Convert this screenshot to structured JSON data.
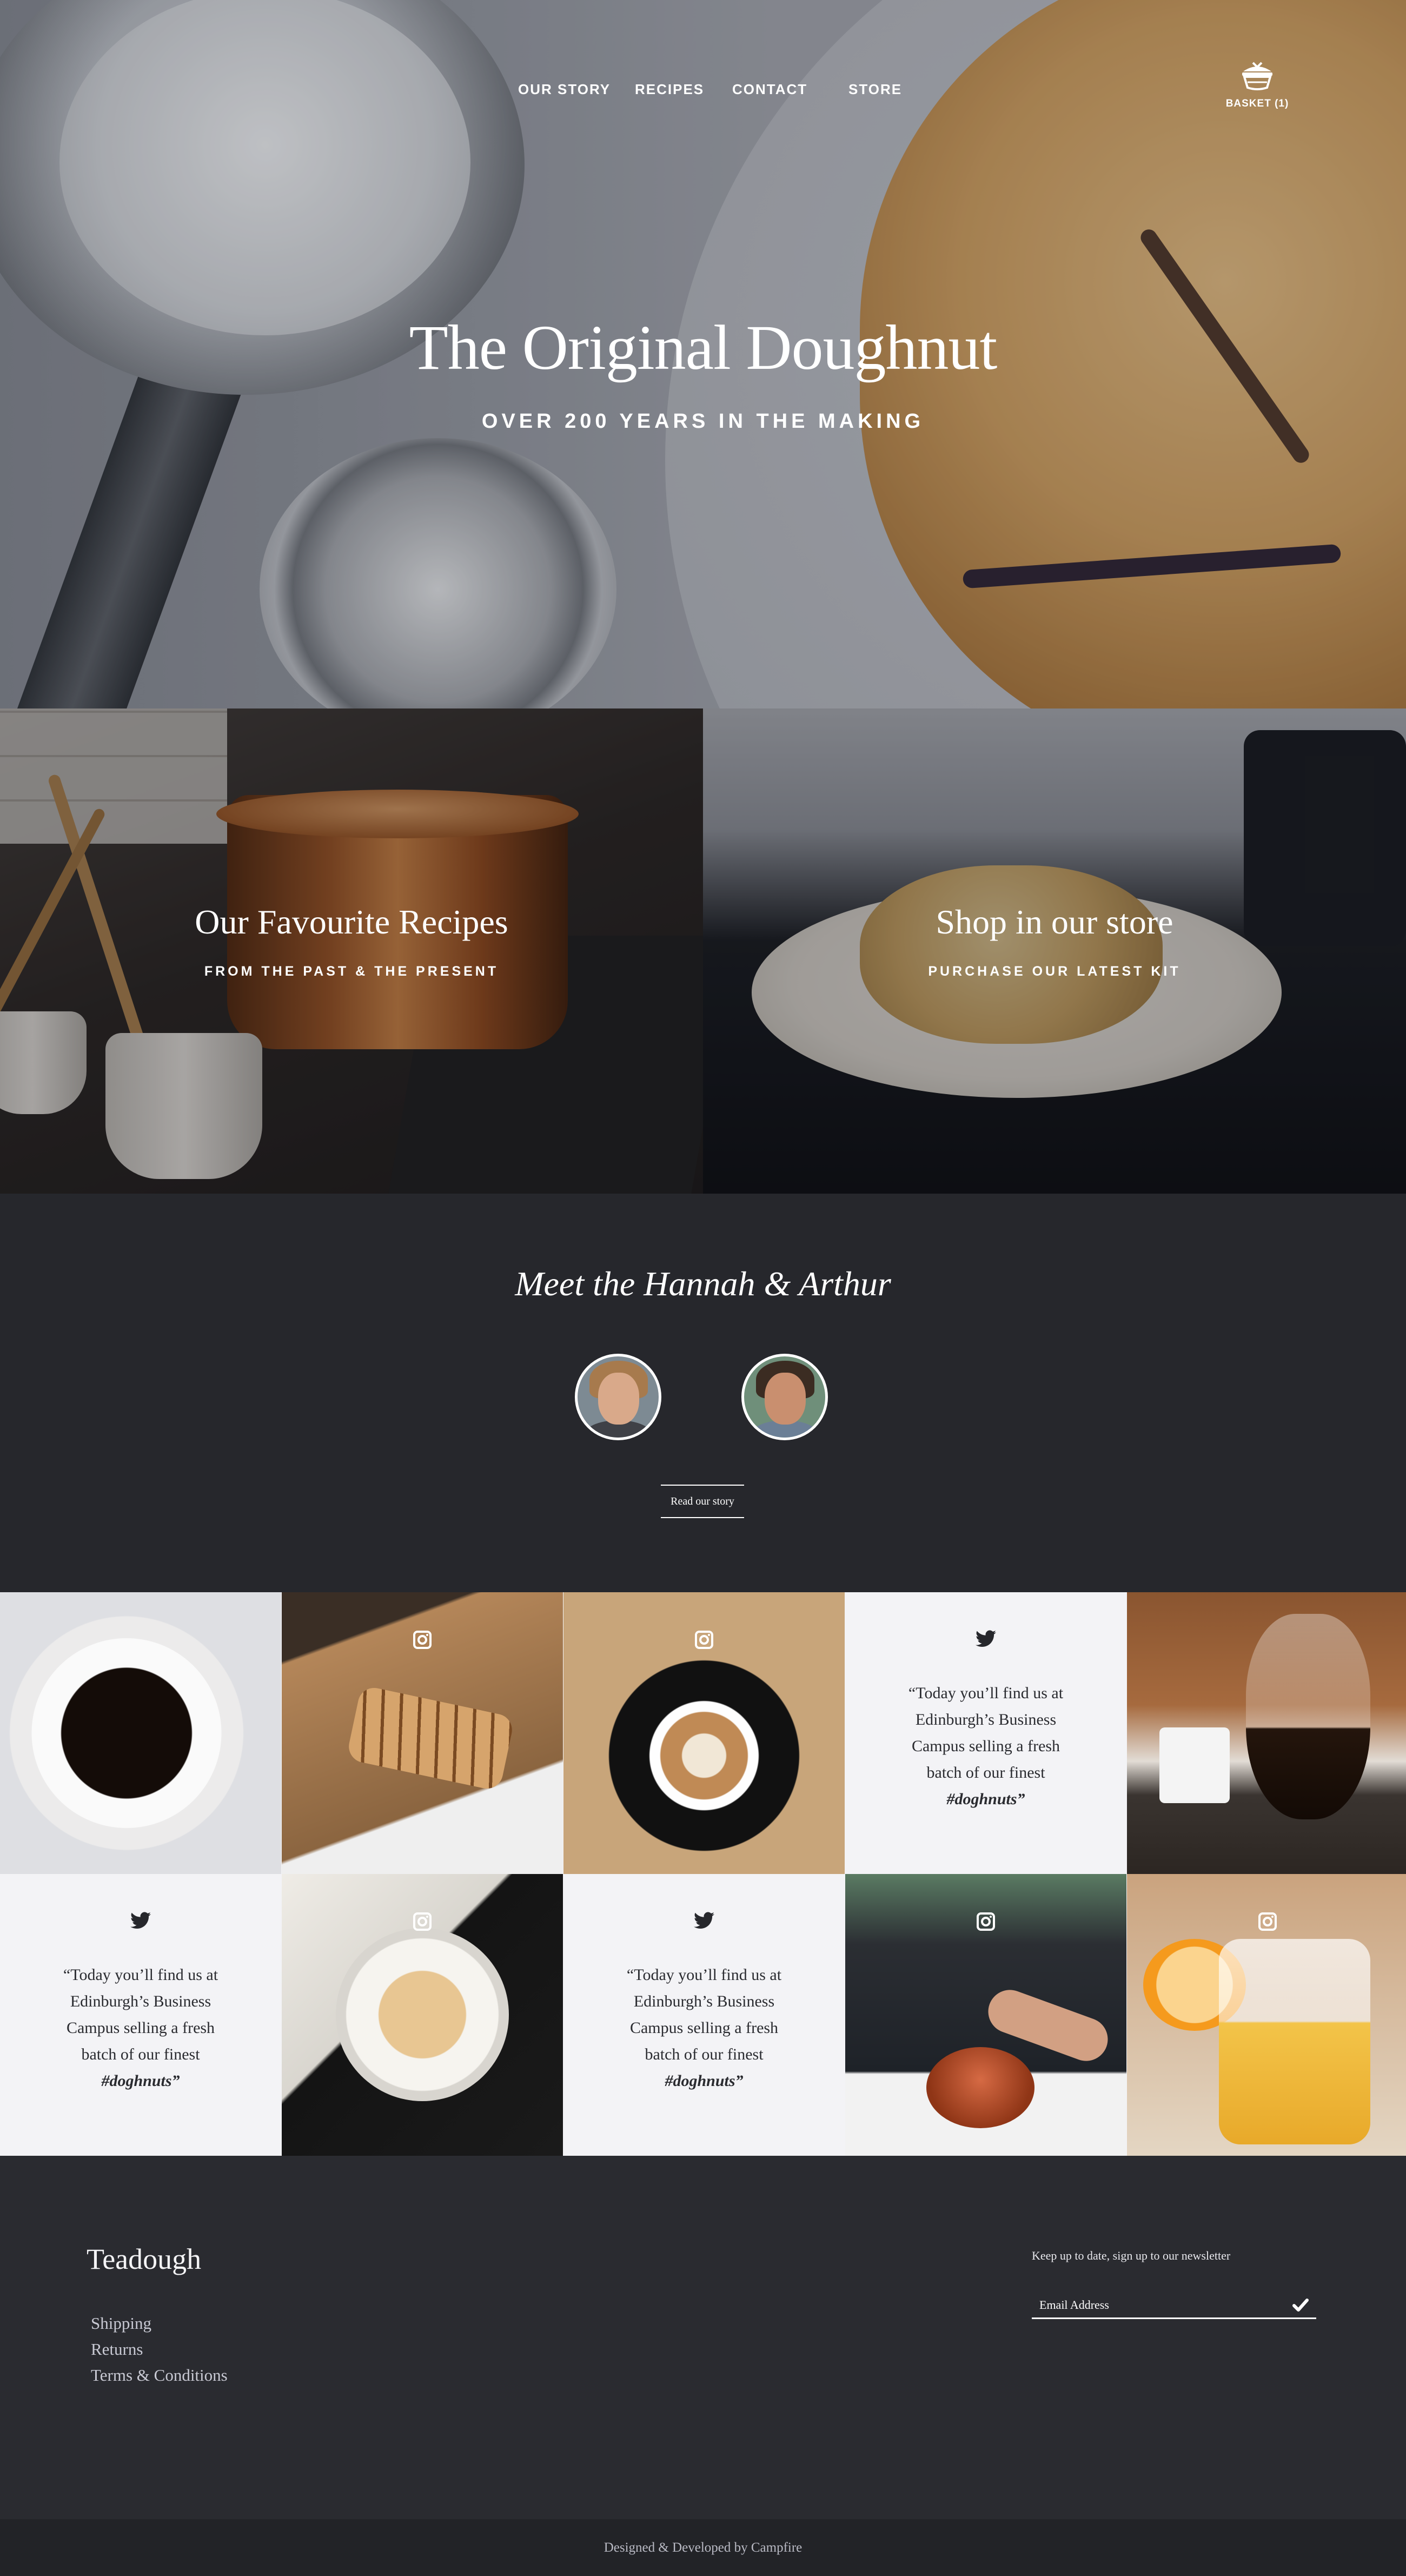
{
  "nav": {
    "items": [
      "OUR STORY",
      "RECIPES",
      "CONTACT",
      "STORE"
    ],
    "basket_label": "BASKET (1)",
    "basket_icon": "basket-icon"
  },
  "hero": {
    "title": "The Original Doughnut",
    "subtitle": "OVER 200 YEARS IN THE MAKING"
  },
  "promos": [
    {
      "title": "Our Favourite Recipes",
      "subtitle": "FROM THE PAST & THE PRESENT"
    },
    {
      "title": "Shop in our store",
      "subtitle": "PURCHASE OUR LATEST KIT"
    }
  ],
  "meet": {
    "title": "Meet the Hannah & Arthur",
    "button": "Read our story"
  },
  "social": {
    "tweet_text": "“Today you’ll find us at Edinburgh’s Business Campus selling a fresh batch of our finest",
    "tweet_tag": "#doghnuts",
    "tweet_close": "”",
    "icons": {
      "twitter": "twitter-icon",
      "instagram": "instagram-icon"
    }
  },
  "footer": {
    "brand": "Teadough",
    "links": [
      "Shipping",
      "Returns",
      "Terms & Conditions"
    ],
    "newsletter_label": "Keep up to date, sign up to our newsletter",
    "email_placeholder": "Email Address",
    "submit_icon": "check-icon",
    "credit": "Designed & Developed by Campfire"
  },
  "colors": {
    "dark_bg": "#26272c",
    "footer_bg": "#2a2b30",
    "tile_bg": "#f3f3f6",
    "text_light": "#ffffff"
  }
}
